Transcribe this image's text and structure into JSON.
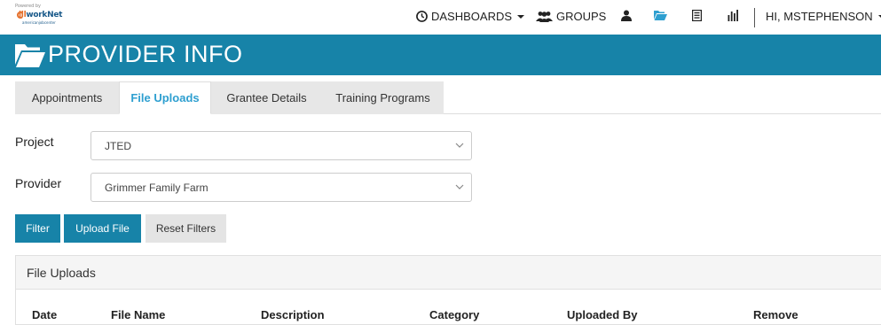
{
  "logo": {
    "line1": "Powered by",
    "brand_prefix": "ill",
    "brand_main": "workNet",
    "line3": "americanjobcenter"
  },
  "nav": {
    "dashboards": "DASHBOARDS",
    "groups": "GROUPS",
    "user_greeting": "HI, MSTEPHENSON"
  },
  "banner": {
    "title": "PROVIDER INFO"
  },
  "tabs": [
    {
      "label": "Appointments",
      "active": false
    },
    {
      "label": "File Uploads",
      "active": true
    },
    {
      "label": "Grantee Details",
      "active": false
    },
    {
      "label": "Training Programs",
      "active": false
    }
  ],
  "form": {
    "project_label": "Project",
    "project_value": "JTED",
    "provider_label": "Provider",
    "provider_value": "Grimmer Family Farm"
  },
  "buttons": {
    "filter": "Filter",
    "upload": "Upload File",
    "reset": "Reset Filters"
  },
  "panel": {
    "title": "File Uploads",
    "columns": [
      "Date",
      "File Name",
      "Description",
      "Category",
      "Uploaded By",
      "Remove"
    ]
  },
  "colors": {
    "brand": "#1783a8",
    "active_tab": "#2e9fd0"
  }
}
